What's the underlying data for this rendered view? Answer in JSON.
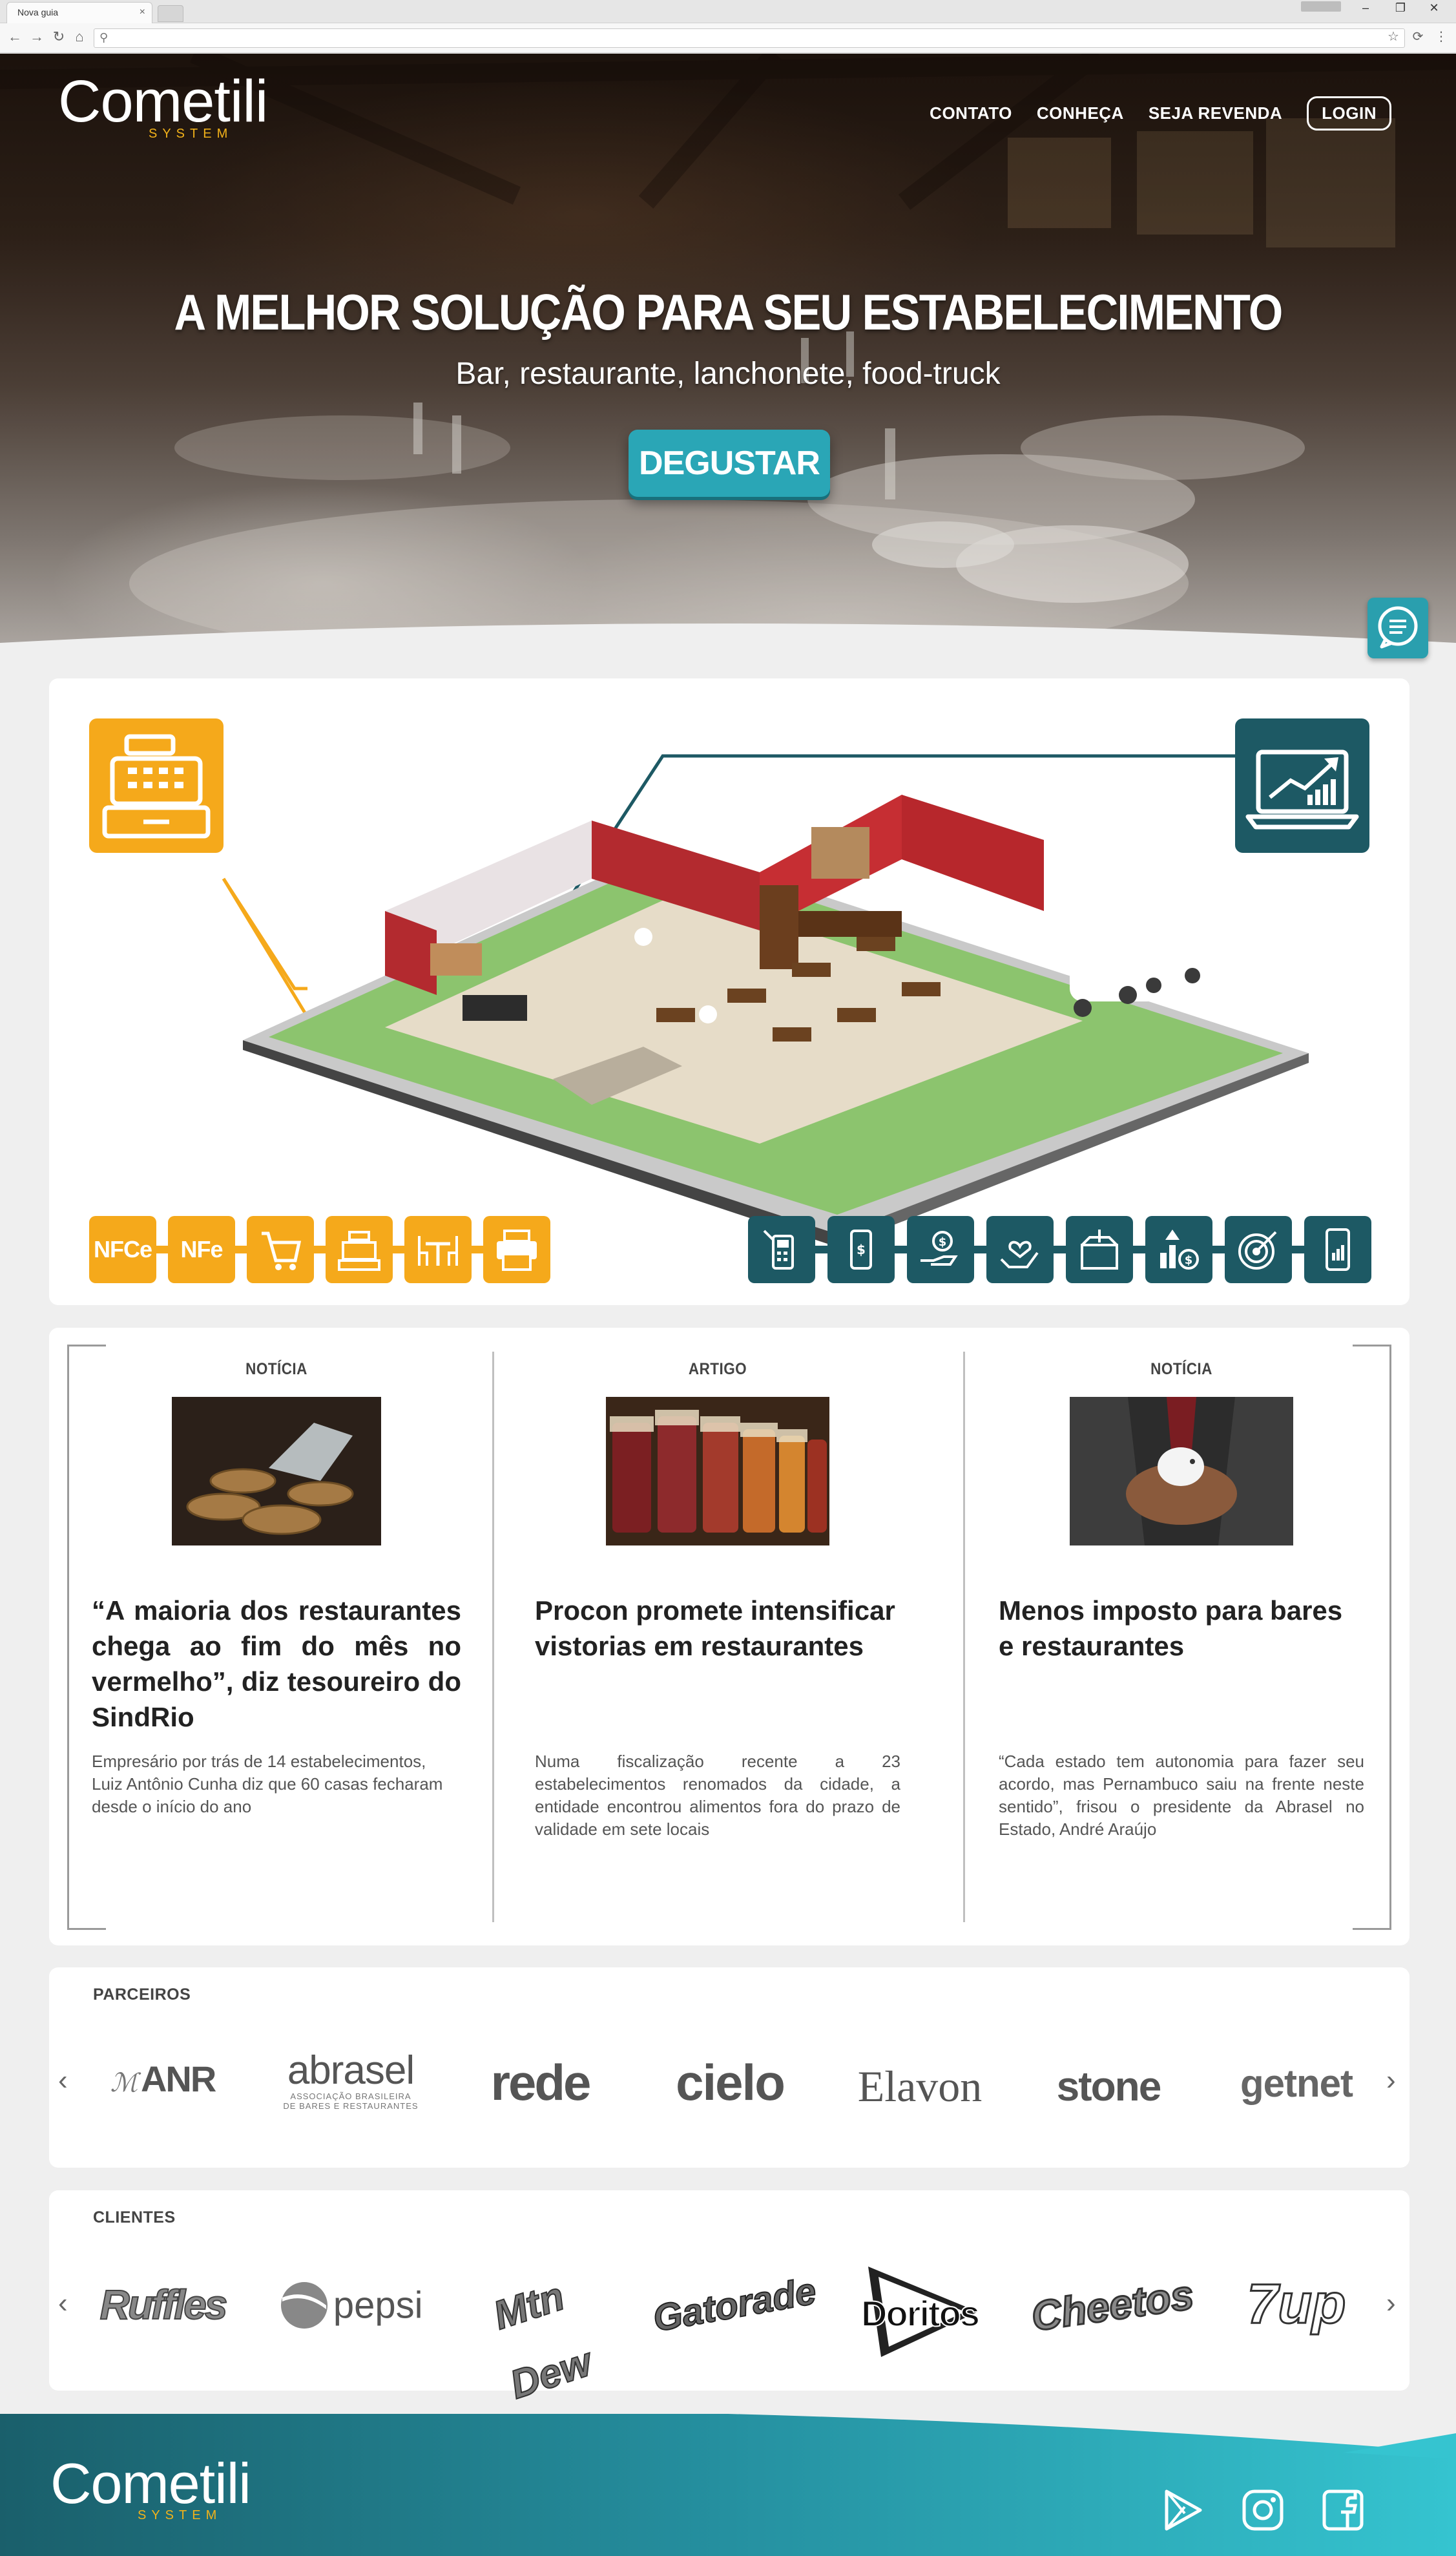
{
  "browser": {
    "tab_title": "Nova guia",
    "tab_close": "×",
    "url": ""
  },
  "hero": {
    "logo_text": "Cometili",
    "logo_sub": "SYSTEM",
    "nav": [
      "CONTATO",
      "CONHEÇA",
      "SEJA REVENDA",
      "LOGIN"
    ],
    "title": "A MELHOR SOLUÇÃO PARA SEU ESTABELECIMENTO",
    "subtitle": "Bar, restaurante, lanchonete, food-truck",
    "cta": "DEGUSTAR"
  },
  "features": {
    "left_tiles": [
      "NFCe",
      "NFe",
      "cart-icon",
      "cash-register-icon",
      "tables-icon",
      "printer-icon"
    ],
    "right_tiles": [
      "pos-terminal-icon",
      "mobile-payment-icon",
      "hand-money-icon",
      "hand-heart-icon",
      "box-icon",
      "growth-money-icon",
      "target-icon",
      "smartphone-chart-icon"
    ],
    "colors": {
      "yellow": "#f5a91b",
      "teal": "#1d5964"
    }
  },
  "news": [
    {
      "tag": "NOTÍCIA",
      "title": "“A maioria dos restaurantes chega ao fim do mês no vermelho”, diz tesoureiro do SindRio",
      "desc": "Empresário por trás de 14 estabelecimentos, Luiz Antônio Cunha diz que 60 casas fecharam desde o início do ano"
    },
    {
      "tag": "ARTIGO",
      "title": "Procon promete intensificar vistorias em restaurantes",
      "desc": "Numa fiscalização recente a 23 estabelecimentos renomados da cidade, a entidade encontrou alimentos fora do prazo de validade em sete locais"
    },
    {
      "tag": "NOTÍCIA",
      "title": "Menos imposto para bares e restaurantes",
      "desc": "“Cada estado tem autonomia para fazer seu acordo, mas Pernambuco saiu na frente neste sentido”, frisou o presidente da Abrasel no Estado, André Araújo"
    }
  ],
  "partners": {
    "label": "PARCEIROS",
    "prev": "‹",
    "next": "›",
    "items": [
      "ANR",
      "abrasel",
      "ASSOCIAÇÃO BRASILEIRA",
      "DE BARES E RESTAURANTES",
      "rede",
      "cielo",
      "Elavon",
      "stone",
      "getnet"
    ]
  },
  "clients": {
    "label": "CLIENTES",
    "prev": "‹",
    "next": "›",
    "items": [
      "Ruffles",
      "pepsi",
      "Mtn Dew",
      "Gatorade",
      "Doritos",
      "Cheetos",
      "7up"
    ]
  },
  "footer": {
    "logo_text": "Cometili",
    "logo_sub": "SYSTEM",
    "social": [
      "play-store-icon",
      "instagram-icon",
      "facebook-icon"
    ]
  }
}
